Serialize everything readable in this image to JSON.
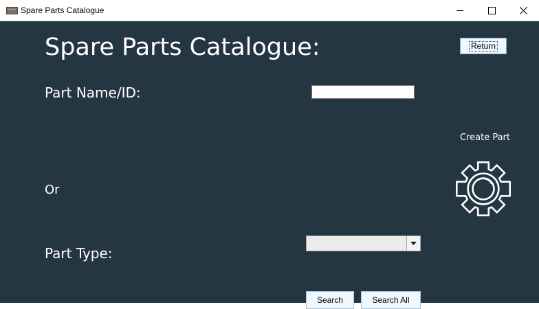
{
  "window": {
    "title": "Spare Parts Catalogue",
    "app_icon": "folder-icon",
    "controls": [
      "minimize-icon",
      "maximize-icon",
      "close-icon"
    ]
  },
  "main": {
    "heading": "Spare Parts Catalogue:",
    "return_label": "Return",
    "part_name_label": "Part Name/ID:",
    "part_name_value": "",
    "or_label": "Or",
    "part_type_label": "Part Type:",
    "part_type_selected": "",
    "create_part_label": "Create Part",
    "create_part_icon": "gear-icon",
    "search_label": "Search",
    "search_all_label": "Search All"
  },
  "colors": {
    "panel_background": "#243642",
    "text": "#ffffff",
    "button_background": "#f0f8ff"
  }
}
